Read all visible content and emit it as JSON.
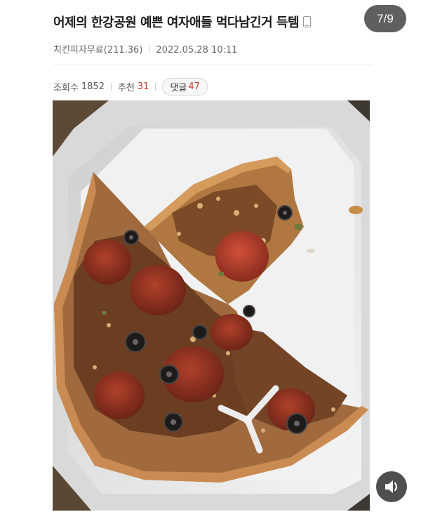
{
  "post": {
    "title": "어제의 한강공원 예쁜 여자애들 먹다남긴거 득템",
    "author": "치킨피자무료(211.36)",
    "datetime": "2022.05.28 10:11"
  },
  "gallery": {
    "counter": "7/9"
  },
  "stats": {
    "views_label": "조회수",
    "views_value": "1852",
    "recommend_label": "추천",
    "recommend_value": "31",
    "comments_label": "댓글",
    "comments_value": "47"
  },
  "photo": {
    "subject": "half-eaten pepperoni olive pizza in open box"
  },
  "icons": {
    "device": "mobile-phone-icon",
    "sound": "speaker-icon"
  },
  "colors": {
    "accent_red": "#c0392b",
    "counter_bg": "#5f5f5f"
  }
}
